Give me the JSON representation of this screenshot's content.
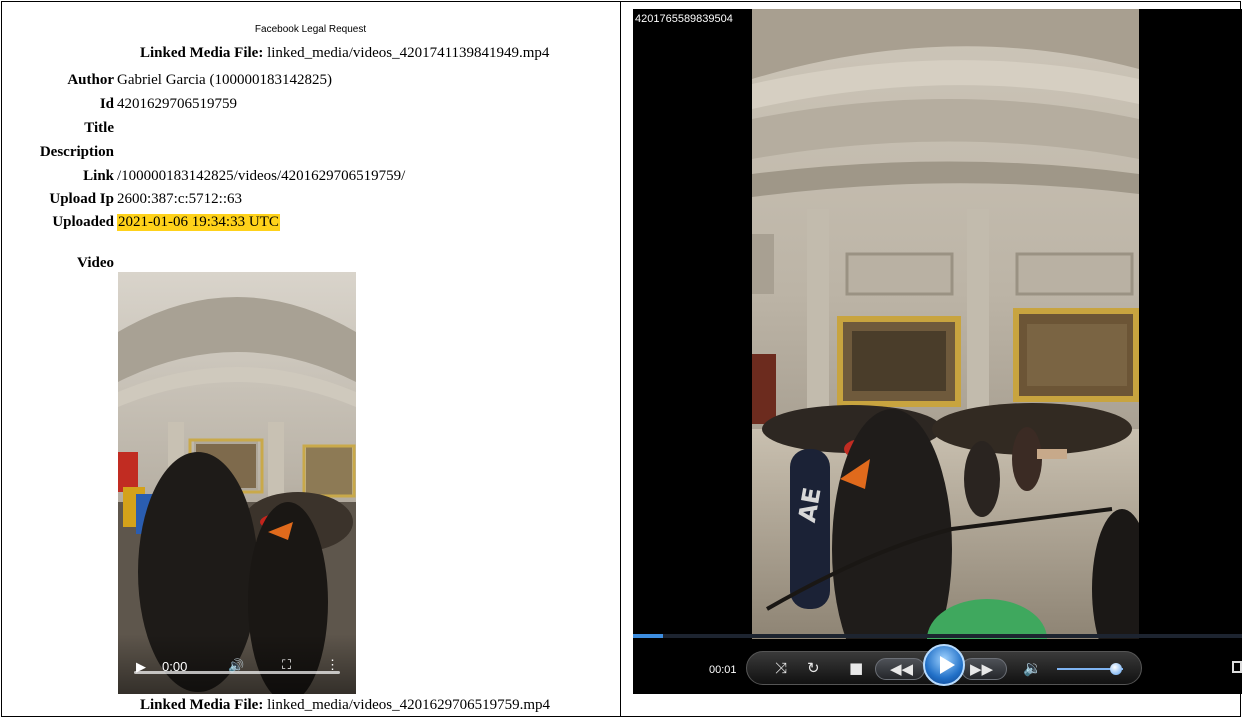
{
  "left": {
    "header": "Facebook Legal Request",
    "linked_top": {
      "label": "Linked Media File:",
      "value": "linked_media/videos_4201741139841949.mp4"
    },
    "fields": [
      {
        "label": "Author",
        "value": "Gabriel Garcia (100000183142825)"
      },
      {
        "label": "Id",
        "value": "4201629706519759"
      },
      {
        "label": "Title",
        "value": ""
      },
      {
        "label": "Description",
        "value": ""
      },
      {
        "label": "Link",
        "value": "/100000183142825/videos/4201629706519759/"
      },
      {
        "label": "Upload Ip",
        "value": "2600:387:c:5712::63"
      },
      {
        "label": "Uploaded",
        "value": "2021-01-06 19:34:33 UTC"
      },
      {
        "label": "Video",
        "value": ""
      }
    ],
    "embedded_player": {
      "time": "0:00",
      "play_icon": "play-icon",
      "volume_icon": "volume-icon",
      "fullscreen_icon": "fullscreen-icon",
      "menu_icon": "more-vertical-icon"
    },
    "linked_bottom": {
      "label": "Linked Media File:",
      "value": "linked_media/videos_4201629706519759.mp4"
    }
  },
  "right": {
    "file_id": "4201765589839504",
    "time": "00:01",
    "progress": 0.05,
    "volume": 0.9,
    "accent_color": "#3d8ddf",
    "controls": [
      "shuffle-icon",
      "repeat-icon",
      "stop-icon",
      "previous-icon",
      "play-icon",
      "next-icon",
      "volume-icon",
      "fullscreen-icon"
    ]
  }
}
